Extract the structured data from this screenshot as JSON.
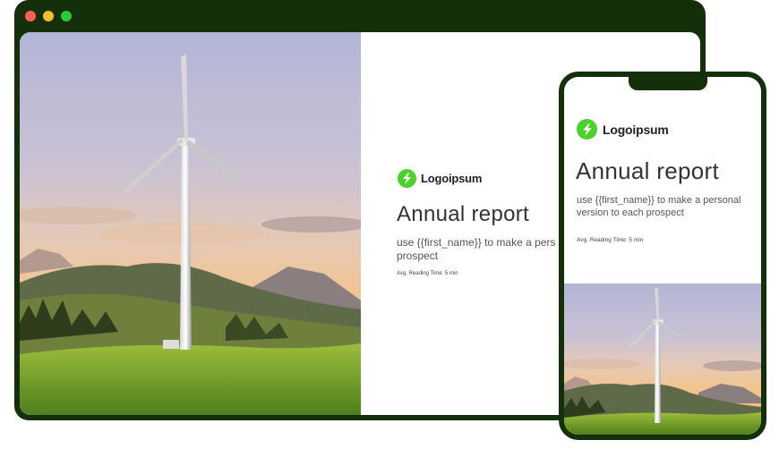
{
  "window": {
    "controls": [
      "close",
      "minimize",
      "maximize"
    ]
  },
  "brand": {
    "name": "Logoipsum",
    "color": "#4ad12a",
    "frame_color": "#14300a"
  },
  "report": {
    "title": "Annual report",
    "subtitle_desktop": "use {{first_name}} to make a pers",
    "subtitle_desktop_line2": "prospect",
    "subtitle_mobile": "use {{first_name}} to make a personal version to each prospect",
    "reading_time": "Avg. Reading Time: 5 min"
  },
  "icons": {
    "logo": "lightning-bolt-icon"
  }
}
